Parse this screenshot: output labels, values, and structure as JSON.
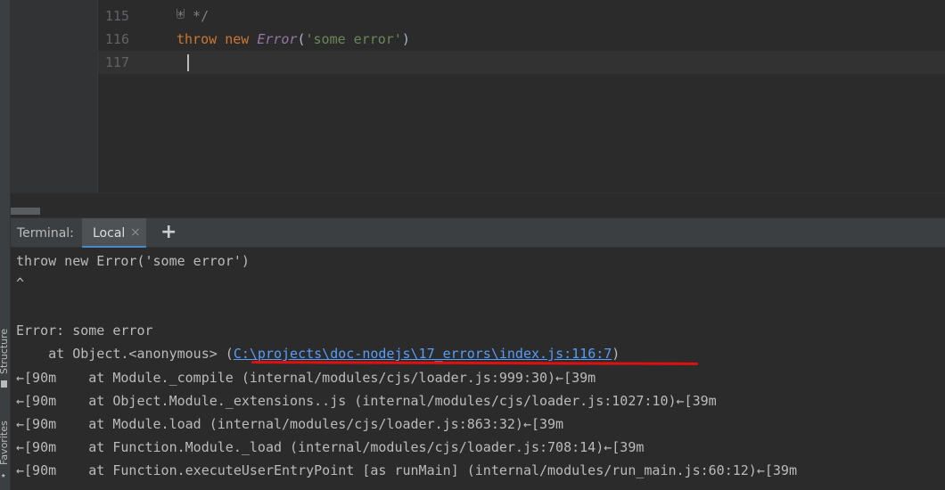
{
  "editor": {
    "lines": [
      {
        "no": "115",
        "code": "* */"
      },
      {
        "no": "116",
        "kw1": "throw",
        "kw2": "new",
        "cls": "Error",
        "open": "(",
        "str": "'some error'",
        "close": ")"
      },
      {
        "no": "117",
        "code": ""
      }
    ]
  },
  "side": {
    "structure_label": "Structure",
    "favorites_label": "Favorites"
  },
  "terminal": {
    "title": "Terminal:",
    "tab_label": "Local",
    "tab_close": "×",
    "add_label": "+",
    "lines": [
      "throw new Error('some error')",
      "^",
      "",
      "Error: some error"
    ],
    "trace_prefix": "    at Object.<anonymous> (",
    "trace_link": "C:\\projects\\doc-nodejs\\17_errors\\index.js:116:7",
    "trace_suffix": ")",
    "stack": [
      "←[90m    at Module._compile (internal/modules/cjs/loader.js:999:30)←[39m",
      "←[90m    at Object.Module._extensions..js (internal/modules/cjs/loader.js:1027:10)←[39m",
      "←[90m    at Module.load (internal/modules/cjs/loader.js:863:32)←[39m",
      "←[90m    at Function.Module._load (internal/modules/cjs/loader.js:708:14)←[39m",
      "←[90m    at Function.executeUserEntryPoint [as runMain] (internal/modules/run_main.js:60:12)←[39m"
    ]
  },
  "colors": {
    "editor_bg": "#2b2b2b",
    "keyword": "#cc7832",
    "class": "#9876aa",
    "string": "#6a8759",
    "link": "#589df6",
    "highlight_underline": "#e01010"
  }
}
